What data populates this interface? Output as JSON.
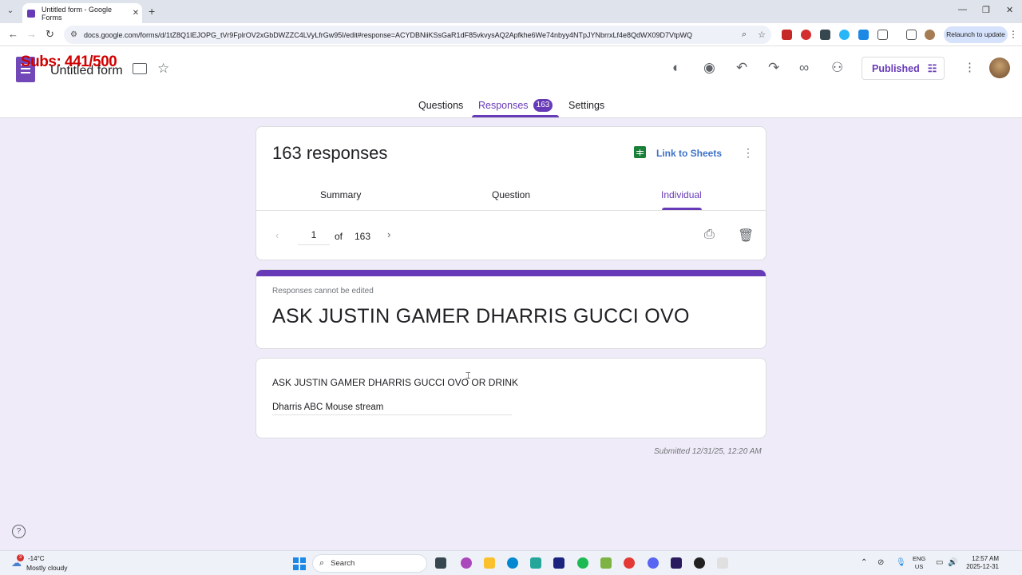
{
  "browser": {
    "tab_title": "Untitled form - Google Forms",
    "url": "docs.google.com/forms/d/1tZ8Q1IEJOPG_tVr9FplrOV2xGbDWZZC4LVyLfrGw95I/edit#response=ACYDBNiiKSsGaR1dF85vkvysAQ2Apfkhe6We74nbyy4NTpJYNbrrxLf4e8QdWX09D7VtpWQ",
    "relaunch_label": "Relaunch to update"
  },
  "overlay": {
    "subs_text": "Subs: 441/500"
  },
  "form": {
    "title": "Untitled form",
    "published_label": "Published",
    "tabs": [
      {
        "label": "Questions"
      },
      {
        "label": "Responses",
        "badge": "163"
      },
      {
        "label": "Settings"
      }
    ],
    "accent_color": "#673ab7"
  },
  "responses": {
    "count_label": "163 responses",
    "link_to_sheets": "Link to Sheets",
    "subtabs": [
      {
        "label": "Summary"
      },
      {
        "label": "Question"
      },
      {
        "label": "Individual"
      }
    ],
    "pager": {
      "current": "1",
      "of_label": "of",
      "total": "163"
    }
  },
  "response": {
    "notice": "Responses cannot be edited",
    "title": "ASK JUSTIN GAMER DHARRIS GUCCI OVO",
    "question": "ASK JUSTIN GAMER DHARRIS GUCCI OVO OR DRINK",
    "answer": "Dharris ABC Mouse stream",
    "submitted": "Submitted 12/31/25, 12:20 AM"
  },
  "taskbar": {
    "weather_badge": "3",
    "temperature": "-14°C",
    "weather_desc": "Mostly cloudy",
    "search_placeholder": "Search",
    "lang_top": "ENG",
    "lang_bottom": "US",
    "time": "12:57 AM",
    "date": "2025-12-31"
  }
}
